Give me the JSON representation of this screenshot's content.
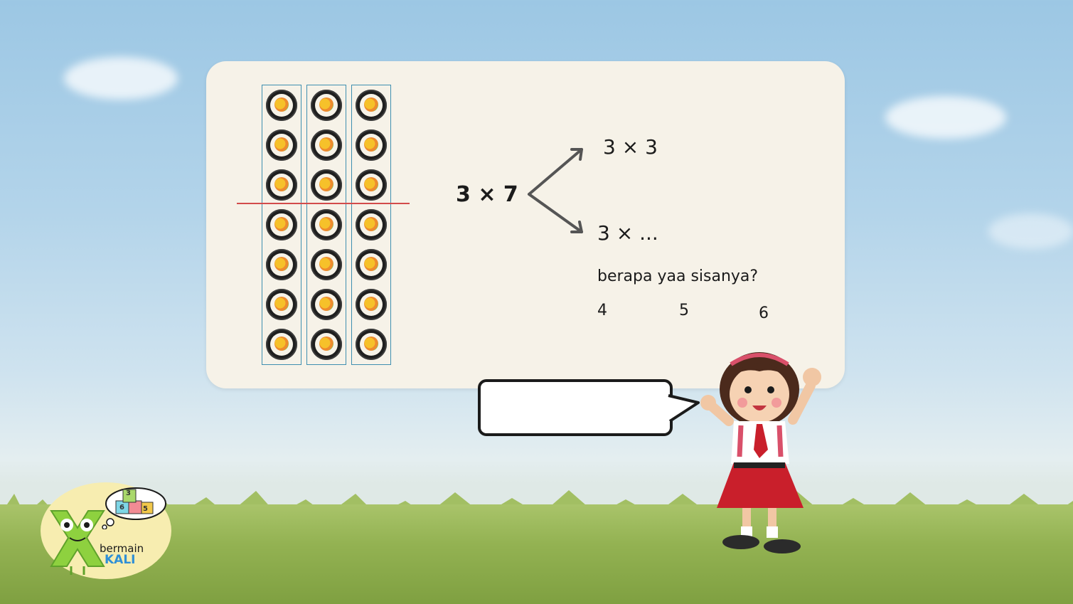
{
  "colors": {
    "sky": "#9cc7e4",
    "card": "#f6f2e8",
    "box_border": "#3f8fb0",
    "divider": "#d24b4b",
    "grass": "#93b252",
    "logo_bg": "#f7edb0",
    "logo_green": "#8ed13f"
  },
  "lesson": {
    "main_equation": "3 × 7",
    "top_equation": "3 × 3",
    "bottom_equation": "3 × ...",
    "question": "berapa yaa sisanya?",
    "options": [
      "4",
      "5",
      "6"
    ],
    "array": {
      "columns": 3,
      "rows": 7,
      "divider_after_row": 3,
      "item_icon": "sushi-roll-icon"
    }
  },
  "speech_bubble": {
    "text": ""
  },
  "logo": {
    "line1": "bermain",
    "line2": "KALI",
    "block_digits": [
      "3",
      "6",
      "5"
    ]
  }
}
